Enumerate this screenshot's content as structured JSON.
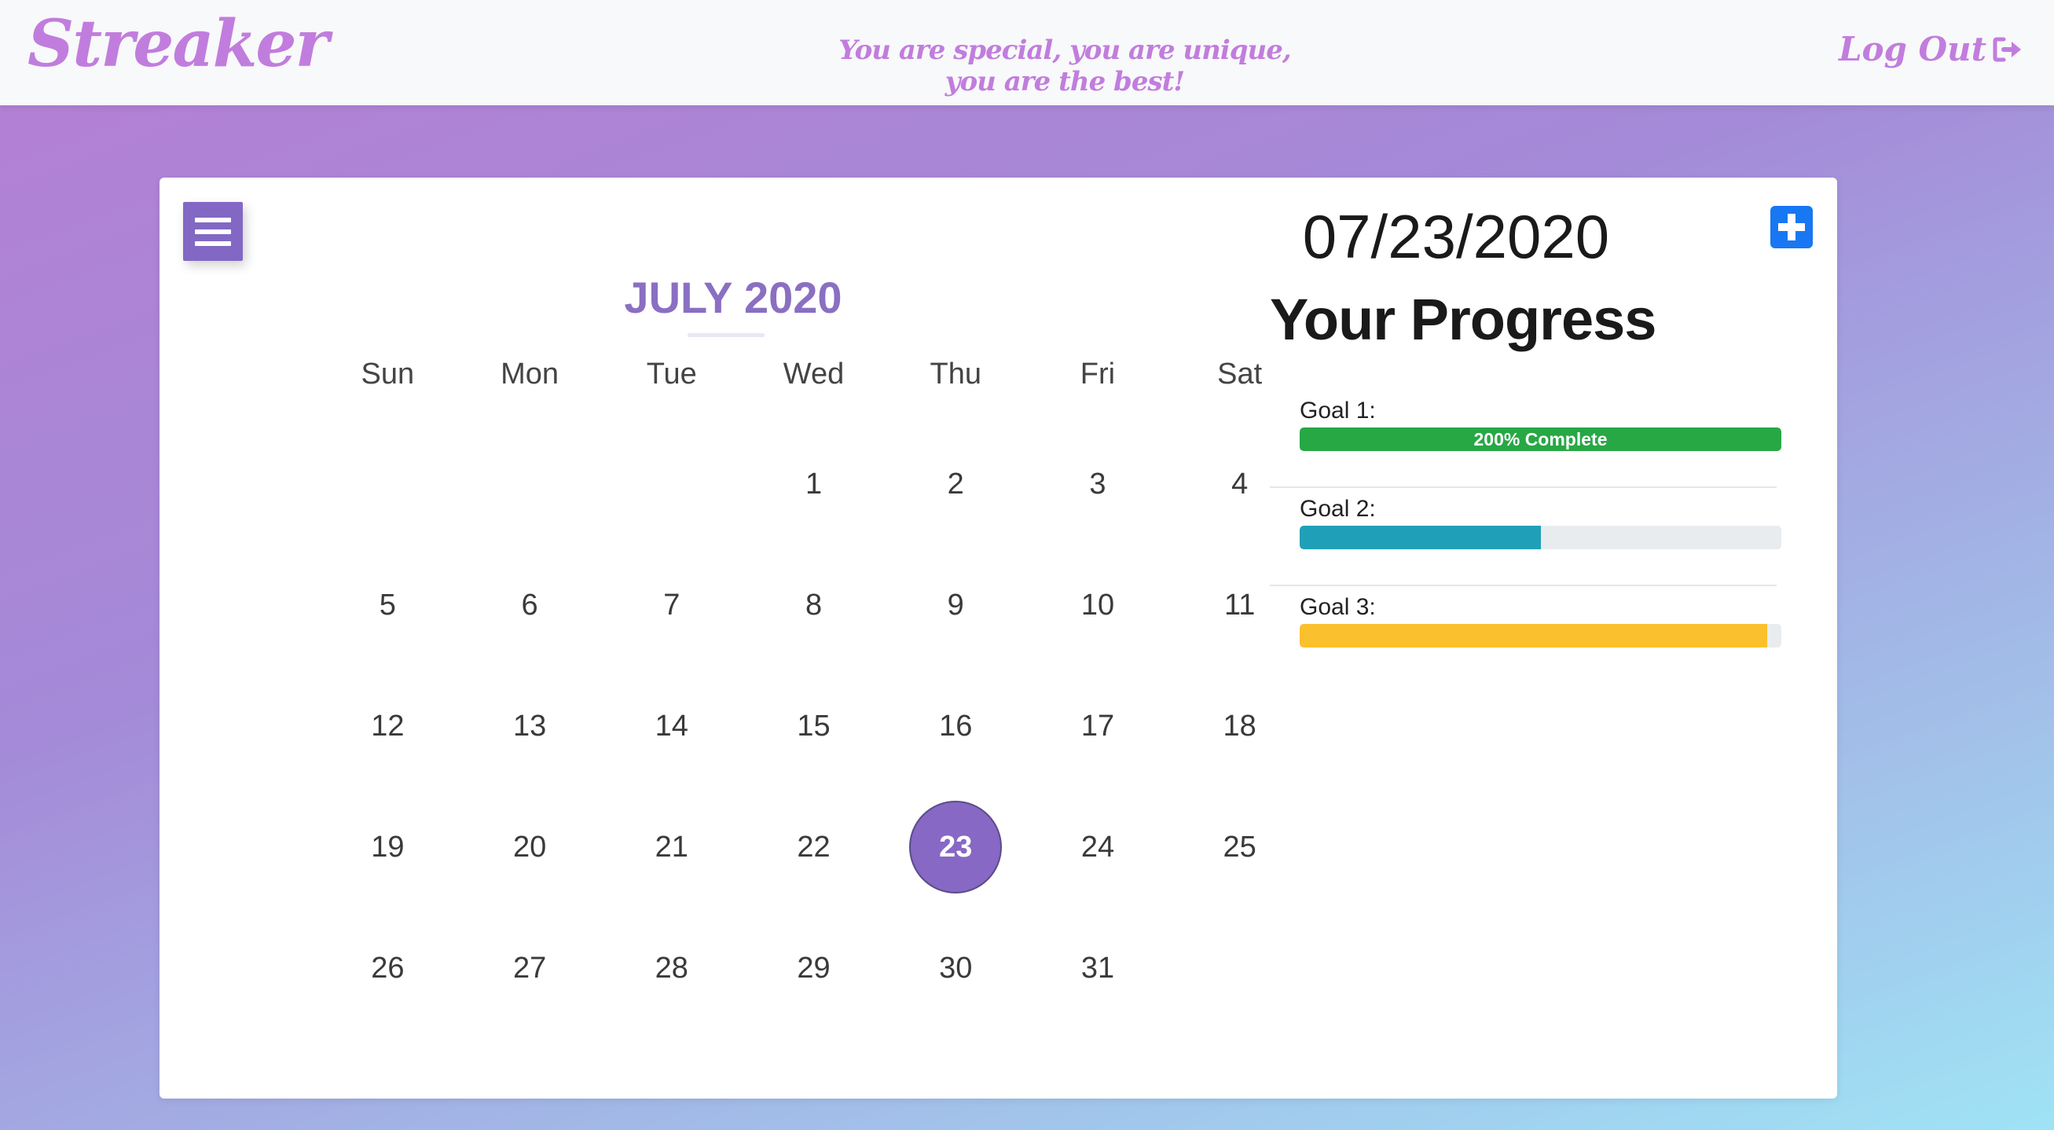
{
  "header": {
    "brand": "Streaker",
    "tagline": "You are special, you are unique, you are the best!",
    "logout_label": "Log Out",
    "logout_icon": "sign-out-icon"
  },
  "calendar": {
    "menu_icon": "hamburger-menu-icon",
    "month_title": "JULY 2020",
    "weekdays": [
      "Sun",
      "Mon",
      "Tue",
      "Wed",
      "Thu",
      "Fri",
      "Sat"
    ],
    "weeks": [
      [
        "",
        "",
        "",
        "1",
        "2",
        "3",
        "4"
      ],
      [
        "5",
        "6",
        "7",
        "8",
        "9",
        "10",
        "11"
      ],
      [
        "12",
        "13",
        "14",
        "15",
        "16",
        "17",
        "18"
      ],
      [
        "19",
        "20",
        "21",
        "22",
        "23",
        "24",
        "25"
      ],
      [
        "26",
        "27",
        "28",
        "29",
        "30",
        "31",
        ""
      ]
    ],
    "selected_day": "23",
    "selected_color": "#8768c4"
  },
  "panel": {
    "date": "07/23/2020",
    "add_icon": "plus-square-icon",
    "progress_title": "Your Progress",
    "goals": [
      {
        "label": "Goal 1:",
        "progress": 1.0,
        "bar_text": "200% Complete",
        "color": "#28a745"
      },
      {
        "label": "Goal 2:",
        "progress": 0.5,
        "bar_text": "",
        "color": "#20a0b8"
      },
      {
        "label": "Goal 3:",
        "progress": 0.97,
        "bar_text": "",
        "color": "#fbc02d"
      }
    ]
  },
  "colors": {
    "brand": "#c17ddd",
    "accent": "#8268c4",
    "add_button": "#1877f2"
  }
}
